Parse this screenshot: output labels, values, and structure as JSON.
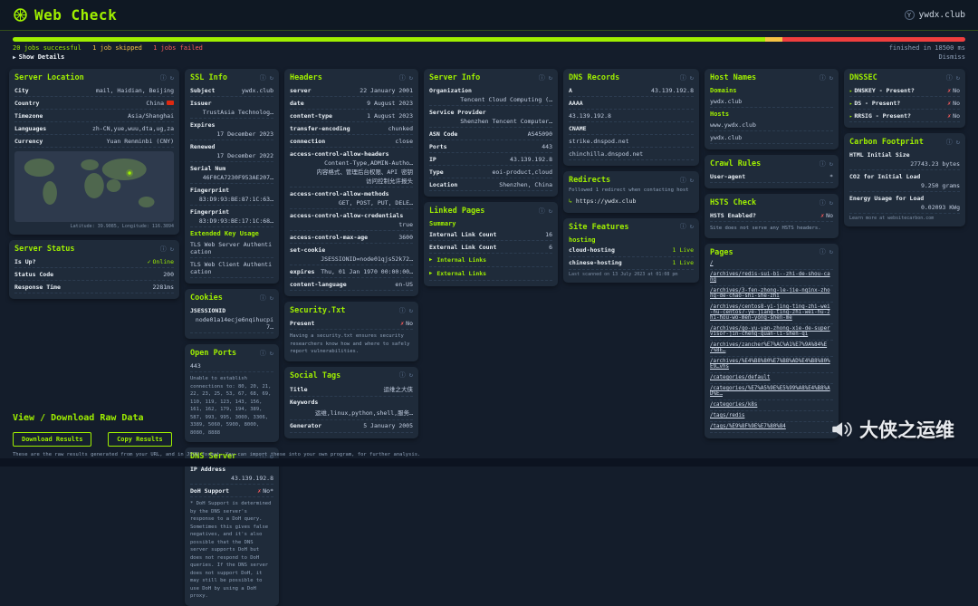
{
  "colors": {
    "accent": "#9fef00",
    "warning": "#f6c344",
    "danger": "#ff5c5c",
    "background": "#141d2b",
    "card": "#1f2b3a",
    "flag": "#de2910"
  },
  "icons": {
    "info": "ⓘ",
    "refresh": "↻",
    "check": "✓",
    "cross": "✗",
    "chevron": "▸",
    "redirect": "↳",
    "expand": "▶"
  },
  "header": {
    "title": "Web Check",
    "site_badge": "Y",
    "site": "ywdx.club"
  },
  "statusbar": {
    "successful": "20 jobs successful",
    "skipped": "1 job skipped",
    "failed": "1 jobs failed",
    "finished": "finished in 18500 ms",
    "dismiss": "Dismiss",
    "show_details": "Show Details"
  },
  "cards": {
    "server_location": {
      "title": "Server Location",
      "rows": [
        {
          "label": "City",
          "value": "mail, Haidian, Beijing"
        },
        {
          "label": "Country",
          "value": "China"
        },
        {
          "label": "Timezone",
          "value": "Asia/Shanghai"
        },
        {
          "label": "Languages",
          "value": "zh-CN,yue,wuu,dta,ug,za"
        },
        {
          "label": "Currency",
          "value": "Yuan Renminbi (CNY)"
        }
      ],
      "map_caption": "Latitude: 39.9085, Longitude: 116.3894"
    },
    "server_status": {
      "title": "Server Status",
      "is_up": {
        "label": "Is Up?",
        "value": "Online"
      },
      "rows": [
        {
          "label": "Status Code",
          "value": "200"
        },
        {
          "label": "Response Time",
          "value": "2281ms"
        }
      ]
    },
    "ssl": {
      "title": "SSL Info",
      "rows": [
        {
          "label": "Subject",
          "value": "ywdx.club"
        },
        {
          "label": "Issuer",
          "value": "TrustAsia Technolog…"
        },
        {
          "label": "Expires",
          "value": "17 December 2023"
        },
        {
          "label": "Renewed",
          "value": "17 December 2022"
        },
        {
          "label": "Serial Num",
          "value": "46F0CA7230F953AE207…"
        },
        {
          "label": "Fingerprint",
          "value": "83:D9:93:BE:87:1C:63…"
        },
        {
          "label": "Fingerprint",
          "value": "83:D9:93:BE:17:1C:68…"
        }
      ],
      "subheading": "Extended Key Usage",
      "usages": [
        "TLS Web Server Authentication",
        "TLS Web Client Authentication"
      ]
    },
    "cookies": {
      "title": "Cookies",
      "rows": [
        {
          "label": "JSESSIONID",
          "value": "node01a14ecje6nqihucpi7…"
        }
      ]
    },
    "open_ports": {
      "title": "Open Ports",
      "open": "443",
      "note": "Unable to establish connections to: 80, 20, 21, 22, 23, 25, 53, 67, 68, 69, 110, 119, 123, 143, 156, 161, 162, 179, 194, 389, 587, 993, 995, 3000, 3306, 3389, 5060, 5900, 8000, 8080, 8888"
    },
    "dns_server": {
      "title": "DNS Server",
      "rows": [
        {
          "label": "IP Address",
          "value": "43.139.192.8"
        }
      ],
      "doh": {
        "label": "DoH Support",
        "value": "No*"
      },
      "note": "* DoH Support is determined by the DNS server's response to a DoH query. Sometimes this gives false negatives, and it's also possible that the DNS server supports DoH but does not respond to DoH queries. If the DNS server does not support DoH, it may still be possible to use DoH by using a DoH proxy."
    },
    "headers": {
      "title": "Headers",
      "rows": [
        {
          "label": "server",
          "value": "22 January 2001"
        },
        {
          "label": "date",
          "value": "9 August 2023"
        },
        {
          "label": "content-type",
          "value": "1 August 2023"
        },
        {
          "label": "transfer-encoding",
          "value": "chunked"
        },
        {
          "label": "connection",
          "value": "close"
        },
        {
          "label": "access-control-allow-headers",
          "value": "Content-Type,ADMIN-Autho…\n内容格式、管理后台权限、API 密钥\n访问控制允许报头"
        },
        {
          "label": "access-control-allow-methods",
          "value": "GET, POST, PUT, DELE…"
        },
        {
          "label": "access-control-allow-credentials",
          "value": "true"
        },
        {
          "label": "access-control-max-age",
          "value": "3600"
        },
        {
          "label": "set-cookie",
          "value": "JSESSIONID=node01qjs52k72…"
        },
        {
          "label": "expires",
          "value": "Thu, 01 Jan 1970 00:00:00…"
        },
        {
          "label": "content-language",
          "value": "en-US"
        }
      ]
    },
    "security_txt": {
      "title": "Security.Txt",
      "row": {
        "label": "Present",
        "value": "No"
      },
      "note": "Having a security.txt ensures security researchers know how and where to safely report vulnerabilities."
    },
    "social_tags": {
      "title": "Social Tags",
      "rows": [
        {
          "label": "Title",
          "value": "运维之大侠"
        },
        {
          "label": "Keywords",
          "value": "运维,linux,python,shell,服务…"
        },
        {
          "label": "Generator",
          "value": "5 January 2005"
        }
      ]
    },
    "server_info": {
      "title": "Server Info",
      "rows": [
        {
          "label": "Organization",
          "value": "Tencent Cloud Computing (…"
        },
        {
          "label": "Service Provider",
          "value": "Shenzhen Tencent Computer…"
        },
        {
          "label": "ASN Code",
          "value": "AS45090"
        },
        {
          "label": "Ports",
          "value": "443"
        },
        {
          "label": "IP",
          "value": "43.139.192.8"
        },
        {
          "label": "Type",
          "value": "eoi-product,cloud"
        },
        {
          "label": "Location",
          "value": "Shenzhen, China"
        }
      ]
    },
    "linked_pages": {
      "title": "Linked Pages",
      "subheading": "Summary",
      "rows": [
        {
          "label": "Internal Link Count",
          "value": "16"
        },
        {
          "label": "External Link Count",
          "value": "6"
        }
      ],
      "expanders": [
        "Internal Links",
        "External Links"
      ]
    },
    "dns_records": {
      "title": "DNS Records",
      "a_row": {
        "label": "A",
        "value": "43.139.192.8"
      },
      "aaaa_label": "AAAA",
      "aaaa_entries": [
        "43.139.192.8"
      ],
      "cname_label": "CNAME",
      "cname_entries": [
        "strike.dnspod.net",
        "chinchilla.dnspod.net"
      ]
    },
    "redirects": {
      "title": "Redirects",
      "summary": "Followed 1 redirect when contacting host",
      "destination": "https://ywdx.club"
    },
    "site_features": {
      "title": "Site Features",
      "subheading": "hosting",
      "rows": [
        {
          "label": "cloud-hosting",
          "value": "1 Live"
        },
        {
          "label": "chinese-hosting",
          "value": "1 Live"
        }
      ],
      "footnote": "Last scanned on 13 July 2023 at 01:08 pm"
    },
    "host_names": {
      "title": "Host Names",
      "domains_label": "Domains",
      "domains": [
        "ywdx.club"
      ],
      "hosts_label": "Hosts",
      "hosts": [
        "www.ywdx.club",
        "ywdx.club"
      ]
    },
    "crawl_rules": {
      "title": "Crawl Rules",
      "rows": [
        {
          "label": "User-agent",
          "value": "*"
        }
      ]
    },
    "hsts": {
      "title": "HSTS Check",
      "row": {
        "label": "HSTS Enabled?",
        "value": "No"
      },
      "note": "Site does not serve any HSTS headers."
    },
    "pages": {
      "title": "Pages",
      "links": [
        "/",
        "/archives/redis-sui-bi--zhi-de-shou-cang",
        "/archives/3-fen-zhong-le-jie-nginx-zhong-de-chao-shi-she-zhi",
        "/archives/centos8-yi-jing-ting-zhi-wei-hu-centos7-ye-jiang-ting-zhi-wei-hu-zhi-hou-wo-men-yong-shen-me",
        "/archives/go-yu-yan-zhong-xie-de-supervisor-jin-cheng-guan-li-shen-qi",
        "/archives/zancher%E7%AC%A1%E7%9A%84%E7%8E…",
        "/archives/%E4%B8%80%E7%B8%AD%E4%B8%80%E9…vhs",
        "/categories/default",
        "/categories/%E7%A5%9E%E5%99%A8%E4%B8%AD%E…",
        "/categories/k8s",
        "/tags/redis",
        "/tags/%E9%8F%9E%E7%80%84"
      ]
    },
    "dnssec": {
      "title": "DNSSEC",
      "rows": [
        {
          "label": "DNSKEY - Present?",
          "value": "No"
        },
        {
          "label": "DS - Present?",
          "value": "No"
        },
        {
          "label": "RRSIG - Present?",
          "value": "No"
        }
      ]
    },
    "carbon": {
      "title": "Carbon Footprint",
      "rows": [
        {
          "label": "HTML Initial Size",
          "value": "27743.23 bytes"
        },
        {
          "label": "CO2 for Initial Load",
          "value": "9.250 grams"
        },
        {
          "label": "Energy Usage for Load",
          "value": "0.02093 KWg"
        }
      ],
      "footnote": "Learn more at websitecarbon.com"
    }
  },
  "rawdata": {
    "title": "View / Download Raw Data",
    "buttons": [
      "Download Results",
      "Copy Results"
    ],
    "note": "These are the raw results generated from your URL, and in JSON format. You can import these into your own program, for further analysis."
  },
  "watermark": {
    "text": "大侠之运维"
  }
}
